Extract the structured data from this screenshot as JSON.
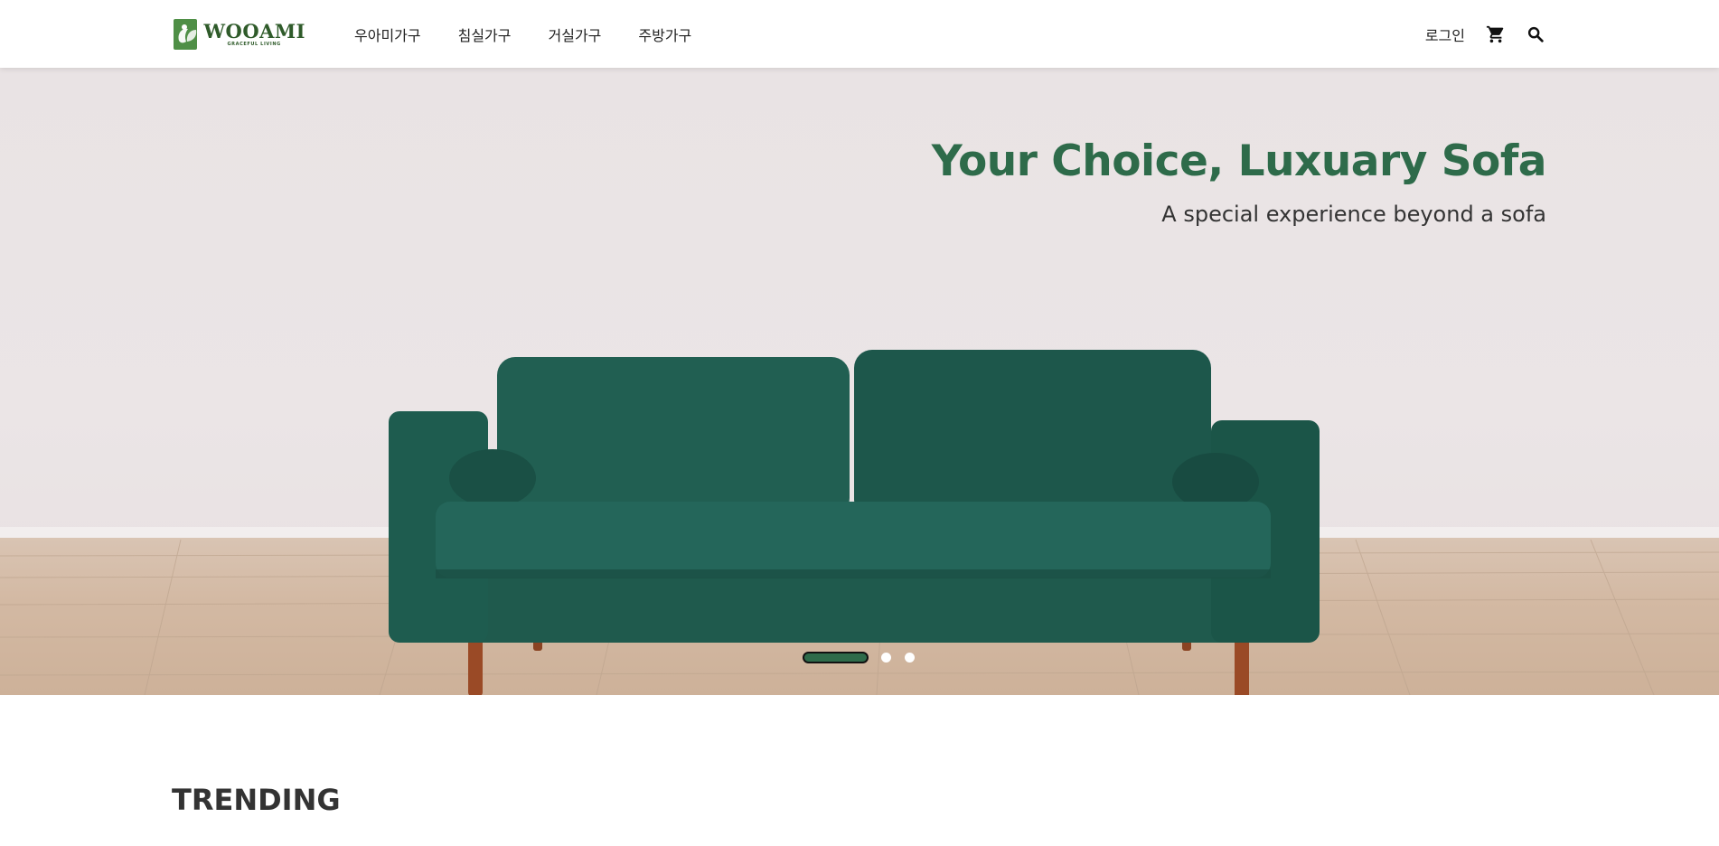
{
  "brand": {
    "name": "WOOAMI",
    "tagline": "GRACEFUL LIVING",
    "color": "#4f8f46"
  },
  "nav": {
    "items": [
      {
        "label": "우아미가구"
      },
      {
        "label": "침실가구"
      },
      {
        "label": "거실가구"
      },
      {
        "label": "주방가구"
      }
    ]
  },
  "util": {
    "login_label": "로그인",
    "cart_icon": "cart-icon",
    "search_icon": "search-icon"
  },
  "hero": {
    "title": "Your Choice, Luxuary Sofa",
    "subtitle": "A special experience beyond a sofa",
    "accent_color": "#2e6b4a",
    "slides_total": 3,
    "active_slide": 1
  },
  "trending": {
    "title": "TRENDING"
  }
}
